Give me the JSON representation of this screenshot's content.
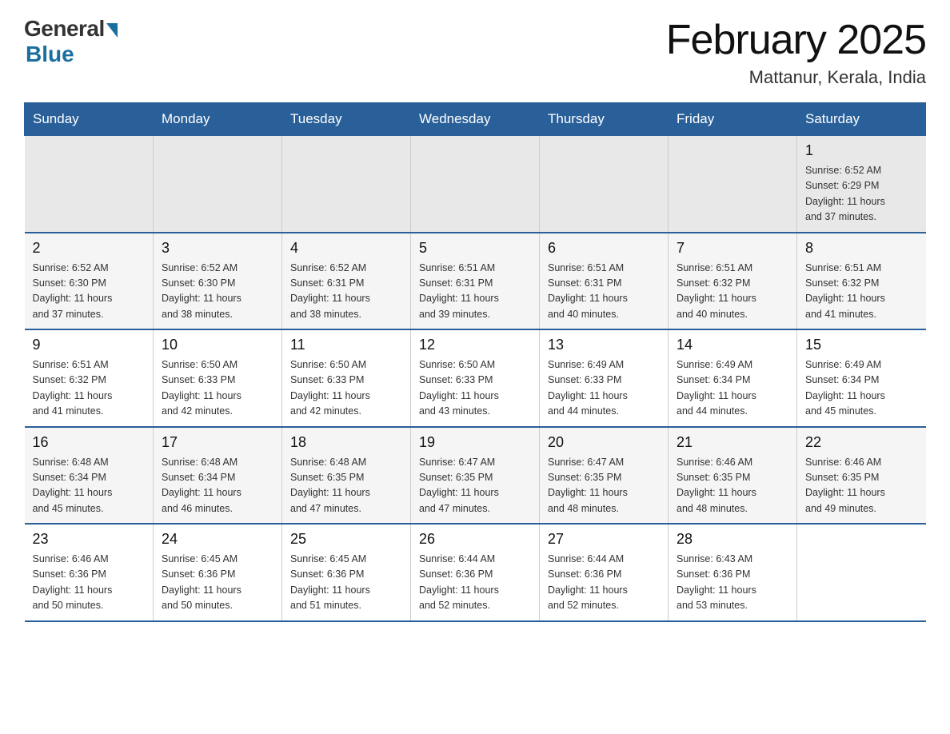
{
  "header": {
    "logo_general": "General",
    "logo_blue": "Blue",
    "month_title": "February 2025",
    "location": "Mattanur, Kerala, India"
  },
  "weekdays": [
    "Sunday",
    "Monday",
    "Tuesday",
    "Wednesday",
    "Thursday",
    "Friday",
    "Saturday"
  ],
  "weeks": [
    {
      "days": [
        {
          "num": "",
          "info": ""
        },
        {
          "num": "",
          "info": ""
        },
        {
          "num": "",
          "info": ""
        },
        {
          "num": "",
          "info": ""
        },
        {
          "num": "",
          "info": ""
        },
        {
          "num": "",
          "info": ""
        },
        {
          "num": "1",
          "info": "Sunrise: 6:52 AM\nSunset: 6:29 PM\nDaylight: 11 hours\nand 37 minutes."
        }
      ]
    },
    {
      "days": [
        {
          "num": "2",
          "info": "Sunrise: 6:52 AM\nSunset: 6:30 PM\nDaylight: 11 hours\nand 37 minutes."
        },
        {
          "num": "3",
          "info": "Sunrise: 6:52 AM\nSunset: 6:30 PM\nDaylight: 11 hours\nand 38 minutes."
        },
        {
          "num": "4",
          "info": "Sunrise: 6:52 AM\nSunset: 6:31 PM\nDaylight: 11 hours\nand 38 minutes."
        },
        {
          "num": "5",
          "info": "Sunrise: 6:51 AM\nSunset: 6:31 PM\nDaylight: 11 hours\nand 39 minutes."
        },
        {
          "num": "6",
          "info": "Sunrise: 6:51 AM\nSunset: 6:31 PM\nDaylight: 11 hours\nand 40 minutes."
        },
        {
          "num": "7",
          "info": "Sunrise: 6:51 AM\nSunset: 6:32 PM\nDaylight: 11 hours\nand 40 minutes."
        },
        {
          "num": "8",
          "info": "Sunrise: 6:51 AM\nSunset: 6:32 PM\nDaylight: 11 hours\nand 41 minutes."
        }
      ]
    },
    {
      "days": [
        {
          "num": "9",
          "info": "Sunrise: 6:51 AM\nSunset: 6:32 PM\nDaylight: 11 hours\nand 41 minutes."
        },
        {
          "num": "10",
          "info": "Sunrise: 6:50 AM\nSunset: 6:33 PM\nDaylight: 11 hours\nand 42 minutes."
        },
        {
          "num": "11",
          "info": "Sunrise: 6:50 AM\nSunset: 6:33 PM\nDaylight: 11 hours\nand 42 minutes."
        },
        {
          "num": "12",
          "info": "Sunrise: 6:50 AM\nSunset: 6:33 PM\nDaylight: 11 hours\nand 43 minutes."
        },
        {
          "num": "13",
          "info": "Sunrise: 6:49 AM\nSunset: 6:33 PM\nDaylight: 11 hours\nand 44 minutes."
        },
        {
          "num": "14",
          "info": "Sunrise: 6:49 AM\nSunset: 6:34 PM\nDaylight: 11 hours\nand 44 minutes."
        },
        {
          "num": "15",
          "info": "Sunrise: 6:49 AM\nSunset: 6:34 PM\nDaylight: 11 hours\nand 45 minutes."
        }
      ]
    },
    {
      "days": [
        {
          "num": "16",
          "info": "Sunrise: 6:48 AM\nSunset: 6:34 PM\nDaylight: 11 hours\nand 45 minutes."
        },
        {
          "num": "17",
          "info": "Sunrise: 6:48 AM\nSunset: 6:34 PM\nDaylight: 11 hours\nand 46 minutes."
        },
        {
          "num": "18",
          "info": "Sunrise: 6:48 AM\nSunset: 6:35 PM\nDaylight: 11 hours\nand 47 minutes."
        },
        {
          "num": "19",
          "info": "Sunrise: 6:47 AM\nSunset: 6:35 PM\nDaylight: 11 hours\nand 47 minutes."
        },
        {
          "num": "20",
          "info": "Sunrise: 6:47 AM\nSunset: 6:35 PM\nDaylight: 11 hours\nand 48 minutes."
        },
        {
          "num": "21",
          "info": "Sunrise: 6:46 AM\nSunset: 6:35 PM\nDaylight: 11 hours\nand 48 minutes."
        },
        {
          "num": "22",
          "info": "Sunrise: 6:46 AM\nSunset: 6:35 PM\nDaylight: 11 hours\nand 49 minutes."
        }
      ]
    },
    {
      "days": [
        {
          "num": "23",
          "info": "Sunrise: 6:46 AM\nSunset: 6:36 PM\nDaylight: 11 hours\nand 50 minutes."
        },
        {
          "num": "24",
          "info": "Sunrise: 6:45 AM\nSunset: 6:36 PM\nDaylight: 11 hours\nand 50 minutes."
        },
        {
          "num": "25",
          "info": "Sunrise: 6:45 AM\nSunset: 6:36 PM\nDaylight: 11 hours\nand 51 minutes."
        },
        {
          "num": "26",
          "info": "Sunrise: 6:44 AM\nSunset: 6:36 PM\nDaylight: 11 hours\nand 52 minutes."
        },
        {
          "num": "27",
          "info": "Sunrise: 6:44 AM\nSunset: 6:36 PM\nDaylight: 11 hours\nand 52 minutes."
        },
        {
          "num": "28",
          "info": "Sunrise: 6:43 AM\nSunset: 6:36 PM\nDaylight: 11 hours\nand 53 minutes."
        },
        {
          "num": "",
          "info": ""
        }
      ]
    }
  ]
}
